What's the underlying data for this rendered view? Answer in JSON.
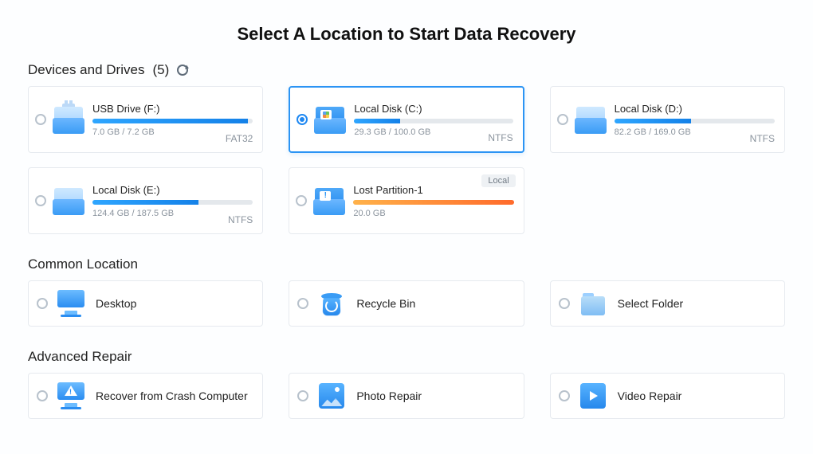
{
  "title": "Select A Location to Start Data Recovery",
  "devices_header": "Devices and Drives",
  "devices_count": "(5)",
  "selected_drive": 1,
  "drives": [
    {
      "name": "USB Drive (F:)",
      "used": "7.0 GB / 7.2 GB",
      "fs": "FAT32",
      "icon": "usb",
      "fill_pct": 97,
      "bar": "blue"
    },
    {
      "name": "Local Disk (C:)",
      "used": "29.3 GB / 100.0 GB",
      "fs": "NTFS",
      "icon": "win",
      "fill_pct": 29,
      "bar": "blue"
    },
    {
      "name": "Local Disk (D:)",
      "used": "82.2 GB / 169.0 GB",
      "fs": "NTFS",
      "icon": "disk",
      "fill_pct": 48,
      "bar": "blue"
    },
    {
      "name": "Local Disk (E:)",
      "used": "124.4 GB / 187.5 GB",
      "fs": "NTFS",
      "icon": "disk",
      "fill_pct": 66,
      "bar": "blue"
    },
    {
      "name": "Lost Partition-1",
      "used": "20.0 GB",
      "fs": "",
      "icon": "alert",
      "fill_pct": 100,
      "bar": "orange",
      "tag": "Local"
    }
  ],
  "common_header": "Common Location",
  "common": [
    {
      "label": "Desktop",
      "icon": "desktop"
    },
    {
      "label": "Recycle Bin",
      "icon": "recycle"
    },
    {
      "label": "Select Folder",
      "icon": "folder"
    }
  ],
  "advanced_header": "Advanced Repair",
  "advanced": [
    {
      "label": "Recover from Crash Computer",
      "icon": "crash"
    },
    {
      "label": "Photo Repair",
      "icon": "photo"
    },
    {
      "label": "Video Repair",
      "icon": "video"
    }
  ]
}
